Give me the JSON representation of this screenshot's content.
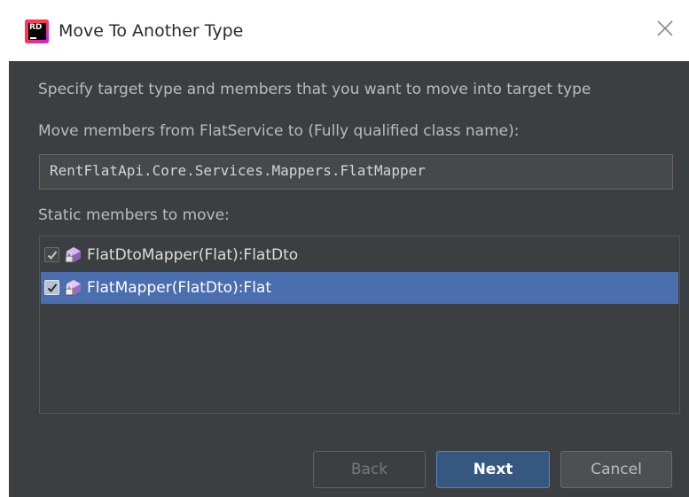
{
  "window": {
    "title": "Move To Another Type",
    "app_icon": "rider-app-icon",
    "app_icon_text": "RD"
  },
  "description": "Specify target type and members that you want to move into target type",
  "target_label": "Move members from FlatService to (Fully qualified class name):",
  "target_value": "RentFlatApi.Core.Services.Mappers.FlatMapper",
  "members_label": "Static members to move:",
  "members": [
    {
      "checked": true,
      "label": "FlatDtoMapper(Flat):FlatDto",
      "icon": "static-method-lock-icon",
      "selected": false
    },
    {
      "checked": true,
      "label": "FlatMapper(FlatDto):Flat",
      "icon": "static-method-lock-icon",
      "selected": true
    }
  ],
  "buttons": {
    "back": "Back",
    "next": "Next",
    "cancel": "Cancel"
  },
  "colors": {
    "panel_bg": "#3c3f41",
    "selection": "#4b6eaf",
    "default_button": "#365880"
  }
}
